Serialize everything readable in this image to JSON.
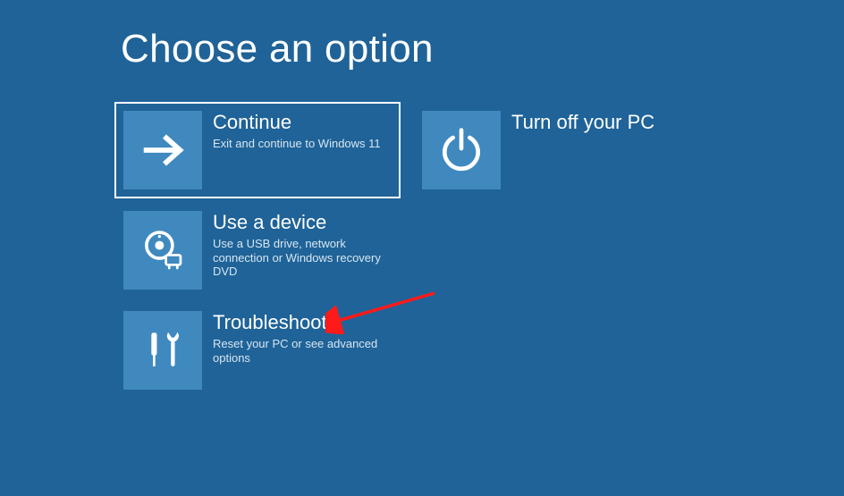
{
  "title": "Choose an option",
  "tiles": {
    "continue": {
      "title": "Continue",
      "desc": "Exit and continue to Windows 11",
      "icon": "arrow-right-icon"
    },
    "turnoff": {
      "title": "Turn off your PC",
      "desc": "",
      "icon": "power-icon"
    },
    "device": {
      "title": "Use a device",
      "desc": "Use a USB drive, network connection or Windows recovery DVD",
      "icon": "device-icon"
    },
    "troubleshoot": {
      "title": "Troubleshoot",
      "desc": "Reset your PC or see advanced options",
      "icon": "tools-icon"
    }
  },
  "annotation": {
    "arrow_target": "troubleshoot",
    "arrow_color": "#ff1a1a"
  },
  "colors": {
    "background": "#1f6398",
    "tile_icon_bg": "#3f89bf",
    "focus_border": "#ffffff"
  }
}
